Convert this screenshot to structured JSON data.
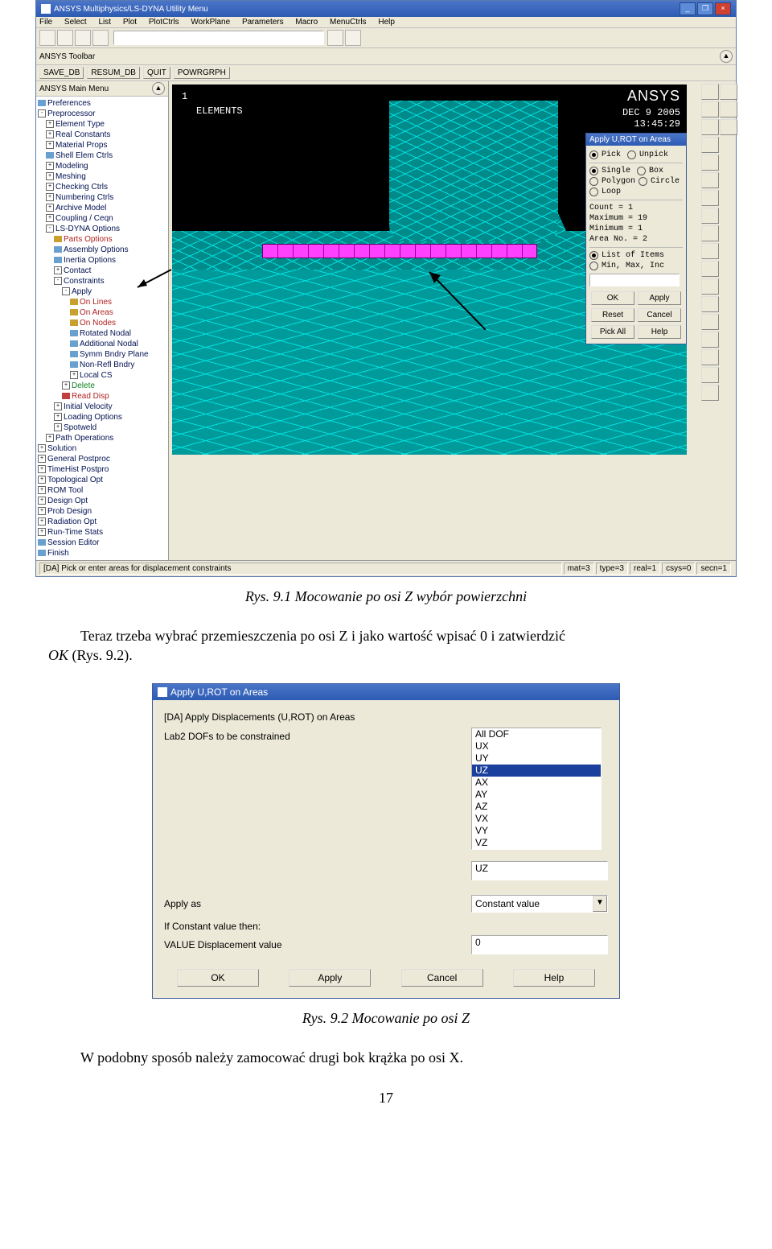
{
  "shot1": {
    "title": "ANSYS Multiphysics/LS-DYNA Utility Menu",
    "menu": [
      "File",
      "Select",
      "List",
      "Plot",
      "PlotCtrls",
      "WorkPlane",
      "Parameters",
      "Macro",
      "MenuCtrls",
      "Help"
    ],
    "toolbar_label": "ANSYS Toolbar",
    "toolbar_buttons": [
      "SAVE_DB",
      "RESUM_DB",
      "QUIT",
      "POWRGRPH"
    ],
    "mainmenu_label": "ANSYS Main Menu",
    "tree": {
      "preferences": "Preferences",
      "preprocessor": "Preprocessor",
      "items1": [
        "Element Type",
        "Real Constants",
        "Material Props",
        "Shell Elem Ctrls",
        "Modeling",
        "Meshing",
        "Checking Ctrls",
        "Numbering Ctrls",
        "Archive Model",
        "Coupling / Ceqn"
      ],
      "lsdyna": "LS-DYNA Options",
      "parts": "Parts Options",
      "assembly": "Assembly Options",
      "inertia": "Inertia Options",
      "contact": "Contact",
      "constraints": "Constraints",
      "apply": "Apply",
      "on_lines": "On Lines",
      "on_areas": "On Areas",
      "on_nodes": "On Nodes",
      "rot_nodal": "Rotated Nodal",
      "add_nodal": "Additional Nodal",
      "symm": "Symm Bndry Plane",
      "nonrefl": "Non-Refl Bndry",
      "localcs": "Local CS",
      "delete": "Delete",
      "read_disp": "Read Disp",
      "init_vel": "Initial Velocity",
      "load_opt": "Loading Options",
      "spotweld": "Spotweld",
      "path_ops": "Path Operations",
      "tail": [
        "Solution",
        "General Postproc",
        "TimeHist Postpro",
        "Topological Opt",
        "ROM Tool",
        "Design Opt",
        "Prob Design",
        "Radiation Opt",
        "Run-Time Stats",
        "Session Editor",
        "Finish"
      ]
    },
    "viewport": {
      "index": "1",
      "label": "ELEMENTS",
      "logo": "ANSYS",
      "date": "DEC  9 2005",
      "time": "13:45:29"
    },
    "pick": {
      "title": "Apply U,ROT on Areas",
      "pick": "Pick",
      "unpick": "Unpick",
      "single": "Single",
      "box": "Box",
      "polygon": "Polygon",
      "circle": "Circle",
      "loop": "Loop",
      "count_lbl": "Count   =",
      "count_v": "1",
      "max_lbl": "Maximum =",
      "max_v": "19",
      "min_lbl": "Minimum =",
      "min_v": "1",
      "area_lbl": "Area No. =",
      "area_v": "2",
      "list_items": "List of Items",
      "minmax": "Min, Max, Inc",
      "ok": "OK",
      "apply": "Apply",
      "reset": "Reset",
      "cancel": "Cancel",
      "pickall": "Pick All",
      "help": "Help"
    },
    "status": {
      "msg": "[DA] Pick or enter areas for displacement constraints",
      "c1": "mat=3",
      "c2": "type=3",
      "c3": "real=1",
      "c4": "csys=0",
      "c5": "secn=1"
    }
  },
  "caption1": "Rys. 9.1 Mocowanie po osi Z wybór powierzchni",
  "para1a": "Teraz trzeba wybrać przemieszczenia po osi Z i jako wartość wpisać 0 i zatwierdzić",
  "para1b_italic": "OK",
  "para1b_tail": " (Rys. 9.2).",
  "dlg2": {
    "title": "Apply U,ROT on Areas",
    "line1": "[DA]   Apply Displacements (U,ROT) on Areas",
    "lab2": "Lab2    DOFs to be constrained",
    "list": [
      "All DOF",
      "UX",
      "UY",
      "UZ",
      "AX",
      "AY",
      "AZ",
      "VX",
      "VY",
      "VZ"
    ],
    "uz_box": "UZ",
    "apply_as": "Apply as",
    "combo_val": "Constant value",
    "if_const": "If Constant value then:",
    "value_lbl": "VALUE   Displacement value",
    "value": "0",
    "ok": "OK",
    "apply": "Apply",
    "cancel": "Cancel",
    "help": "Help"
  },
  "caption2": "Rys. 9.2 Mocowanie po osi Z",
  "para2": "W podobny sposób należy zamocować drugi bok krążka po osi X.",
  "page_num": "17"
}
